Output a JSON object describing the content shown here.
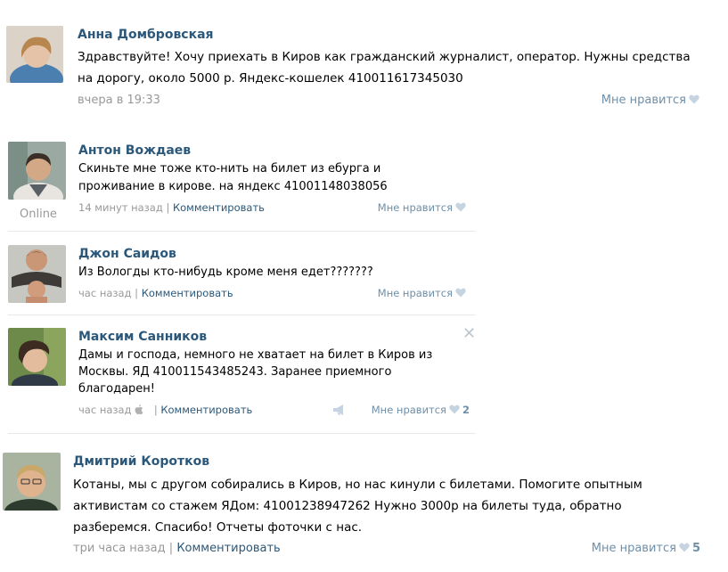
{
  "posts": [
    {
      "author": "Анна Домбровская",
      "text": "Здравствуйте! Хочу приехать в Киров как гражданский журналист, оператор. Нужны средства на дорогу, около 5000 р. Яндекс-кошелек 410011617345030",
      "time": "вчера в 19:33",
      "like_label": "Мне нравится"
    },
    {
      "author": "Антон Вождаев",
      "status": "Online",
      "text": "Скиньте мне тоже кто-нить на билет из ебурга и проживание в кирове. на яндекс 41001148038056",
      "time": "14 минут назад",
      "comment_label": "Комментировать",
      "like_label": "Мне нравится"
    },
    {
      "author": "Джон Саидов",
      "text": "Из Вологды кто-нибудь кроме меня едет???????",
      "time": "час назад",
      "comment_label": "Комментировать",
      "like_label": "Мне нравится"
    },
    {
      "author": "Максим Санников",
      "text": "Дамы и господа, немного не хватает на билет в Киров из Москвы. ЯД 410011543485243. Заранее приемного благодарен!",
      "time": "час назад",
      "comment_label": "Комментировать",
      "like_label": "Мне нравится",
      "like_count": "2"
    },
    {
      "author": "Дмитрий Коротков",
      "text": "Котаны, мы с другом собирались в Киров, но нас кинули с билетами. Помогите опытным активистам со стажем ЯДом: 41001238947262 Нужно 3000р на билеты туда, обратно разберемся. Спасибо! Отчеты фоточки с нас.",
      "time": "три часа назад",
      "comment_label": "Комментировать",
      "like_label": "Мне нравится",
      "like_count": "5"
    }
  ],
  "colors": {
    "link": "#2b587a",
    "meta": "#999999",
    "like": "#6f8fa8",
    "divider": "#e7e8ec"
  },
  "icons": [
    "heart-icon",
    "apple-icon",
    "megaphone-icon",
    "close-icon"
  ]
}
